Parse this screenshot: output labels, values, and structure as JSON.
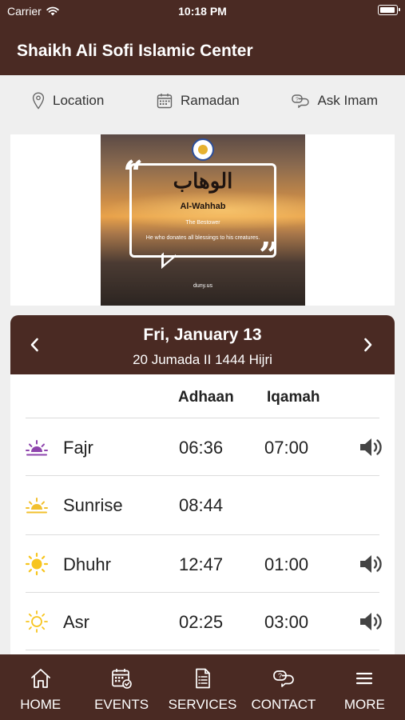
{
  "status_bar": {
    "carrier": "Carrier",
    "time": "10:18 PM"
  },
  "header": {
    "title": "Shaikh Ali Sofi Islamic Center"
  },
  "quick_links": [
    {
      "label": "Location",
      "icon": "location-pin-icon"
    },
    {
      "label": "Ramadan",
      "icon": "calendar-icon"
    },
    {
      "label": "Ask Imam",
      "icon": "chat-bubbles-icon"
    }
  ],
  "banner": {
    "arabic": "الوهاب",
    "name": "Al-Wahhab",
    "meaning": "The Bestower",
    "description": "He who donates all blessings to his creatures.",
    "site": "duny.us"
  },
  "prayer_card": {
    "date": "Fri, January 13",
    "hijri": "20 Jumada II 1444 Hijri",
    "columns": {
      "adhaan": "Adhaan",
      "iqamah": "Iqamah"
    },
    "rows": [
      {
        "name": "Fajr",
        "adhaan": "06:36",
        "iqamah": "07:00",
        "icon": "sunrise-purple-icon",
        "icon_color": "#8e44ad",
        "has_audio": true
      },
      {
        "name": "Sunrise",
        "adhaan": "08:44",
        "iqamah": "",
        "icon": "sunrise-yellow-icon",
        "icon_color": "#f2c02e",
        "has_audio": false
      },
      {
        "name": "Dhuhr",
        "adhaan": "12:47",
        "iqamah": "01:00",
        "icon": "sun-filled-icon",
        "icon_color": "#f7c51e",
        "has_audio": true
      },
      {
        "name": "Asr",
        "adhaan": "02:25",
        "iqamah": "03:00",
        "icon": "sun-outline-icon",
        "icon_color": "#f7c51e",
        "has_audio": true
      }
    ]
  },
  "tabbar": [
    {
      "label": "HOME",
      "icon": "home-icon"
    },
    {
      "label": "EVENTS",
      "icon": "calendar-check-icon"
    },
    {
      "label": "SERVICES",
      "icon": "document-list-icon"
    },
    {
      "label": "CONTACT",
      "icon": "chat-bubbles-icon"
    },
    {
      "label": "MORE",
      "icon": "menu-icon"
    }
  ],
  "colors": {
    "brand": "#4a2a23",
    "background": "#efefef",
    "card": "#ffffff"
  }
}
